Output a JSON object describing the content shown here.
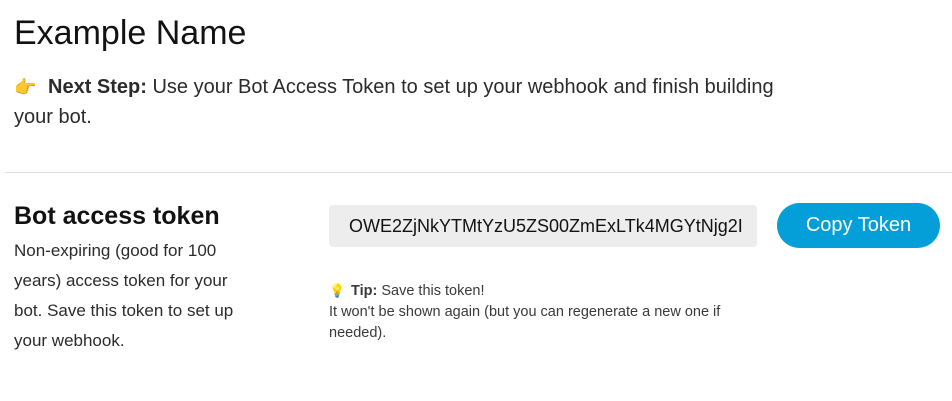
{
  "header": {
    "title": "Example Name"
  },
  "next_step": {
    "icon": "pointing-hand-icon",
    "icon_glyph": "👉",
    "label": "Next Step:",
    "text": " Use your Bot Access Token to set up your webhook and finish building your bot."
  },
  "token_section": {
    "title": "Bot access token",
    "description": "Non-expiring (good for 100 years) access token for your bot. Save this token to set up your webhook.",
    "token_value": "OWE2ZjNkYTMtYzU5ZS00ZmExLTk4MGYtNjg2I",
    "copy_button_label": "Copy Token"
  },
  "tip": {
    "icon": "lightbulb-icon",
    "icon_glyph": "💡",
    "label": "Tip:",
    "line1": " Save this token!",
    "line2": "It won't be shown again (but you can regenerate a new one if needed)."
  },
  "colors": {
    "accent": "#049fd9",
    "token_bg": "#ededed",
    "divider": "#dedede"
  }
}
